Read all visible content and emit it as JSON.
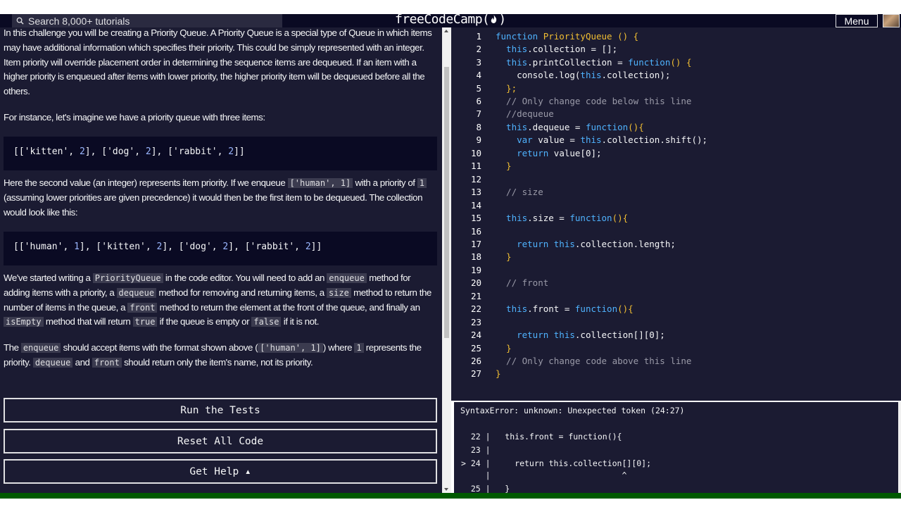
{
  "navbar": {
    "search_placeholder": "Search 8,000+ tutorials",
    "logo_left": "freeCodeCamp(",
    "logo_right": ")",
    "menu_label": "Menu"
  },
  "description": {
    "p1": "In this challenge you will be creating a Priority Queue. A Priority Queue is a special type of Queue in which items may have additional information which specifies their priority. This could be simply represented with an integer. Item priority will override placement order in determining the sequence items are dequeued. If an item with a higher priority is enqueued after items with lower priority, the higher priority item will be dequeued before all the others.",
    "p2": "For instance, let's imagine we have a priority queue with three items:",
    "block1": [
      {
        "t": "[['",
        "c": "s"
      },
      {
        "t": "kitten",
        "c": "s"
      },
      {
        "t": "', ",
        "c": "s"
      },
      {
        "t": "2",
        "c": "n"
      },
      {
        "t": "], ['dog', ",
        "c": "s"
      },
      {
        "t": "2",
        "c": "n"
      },
      {
        "t": "], ['rabbit', ",
        "c": "s"
      },
      {
        "t": "2",
        "c": "n"
      },
      {
        "t": "]]",
        "c": "s"
      }
    ],
    "p3": {
      "a": "Here the second value (an integer) represents item priority. If we enqueue ",
      "code1": "['human', 1]",
      "b": " with a priority of ",
      "code2": "1",
      "c": " (assuming lower priorities are given precedence) it would then be the first item to be dequeued. The collection would look like this:"
    },
    "block2": [
      {
        "t": "[['human', ",
        "c": "s"
      },
      {
        "t": "1",
        "c": "n"
      },
      {
        "t": "], ['kitten', ",
        "c": "s"
      },
      {
        "t": "2",
        "c": "n"
      },
      {
        "t": "], ['dog', ",
        "c": "s"
      },
      {
        "t": "2",
        "c": "n"
      },
      {
        "t": "], ['rabbit', ",
        "c": "s"
      },
      {
        "t": "2",
        "c": "n"
      },
      {
        "t": "]]",
        "c": "s"
      }
    ],
    "p4": {
      "a": "We've started writing a ",
      "code1": "PriorityQueue",
      "b": " in the code editor. You will need to add an ",
      "code2": "enqueue",
      "c": " method for adding items with a priority, a ",
      "code3": "dequeue",
      "d": " method for removing and returning items, a ",
      "code4": "size",
      "e": " method to return the number of items in the queue, a ",
      "code5": "front",
      "f": " method to return the element at the front of the queue, and finally an ",
      "code6": "isEmpty",
      "g": " method that will return ",
      "code7": "true",
      "h": " if the queue is empty or ",
      "code8": "false",
      "i": " if it is not."
    },
    "p5": {
      "a": "The ",
      "code1": "enqueue",
      "b": " should accept items with the format shown above (",
      "code2": "['human', 1]",
      "c": ") where ",
      "code3": "1",
      "d": " represents the priority. ",
      "code4": "dequeue",
      "e": " and ",
      "code5": "front",
      "f": " should return only the item's name, not its priority."
    }
  },
  "buttons": {
    "run": "Run the Tests",
    "reset": "Reset All Code",
    "help": "Get Help ▴"
  },
  "editor": {
    "lines": [
      {
        "n": "1",
        "tokens": [
          {
            "t": "function ",
            "c": "kw"
          },
          {
            "t": "PriorityQueue",
            "c": "fn"
          },
          {
            "t": " () {",
            "c": "br"
          }
        ]
      },
      {
        "n": "2",
        "tokens": [
          {
            "t": "  this",
            "c": "kw"
          },
          {
            "t": ".collection = [];",
            "c": "txt"
          }
        ]
      },
      {
        "n": "3",
        "tokens": [
          {
            "t": "  this",
            "c": "kw"
          },
          {
            "t": ".printCollection = ",
            "c": "txt"
          },
          {
            "t": "function",
            "c": "kw"
          },
          {
            "t": "() {",
            "c": "br"
          }
        ]
      },
      {
        "n": "4",
        "tokens": [
          {
            "t": "    console.log(",
            "c": "txt"
          },
          {
            "t": "this",
            "c": "kw"
          },
          {
            "t": ".collection);",
            "c": "txt"
          }
        ]
      },
      {
        "n": "5",
        "tokens": [
          {
            "t": "  };",
            "c": "br"
          }
        ]
      },
      {
        "n": "6",
        "tokens": [
          {
            "t": "  // Only change code below this line",
            "c": "cm"
          }
        ]
      },
      {
        "n": "7",
        "tokens": [
          {
            "t": "  //dequeue",
            "c": "cm"
          }
        ]
      },
      {
        "n": "8",
        "tokens": [
          {
            "t": "  this",
            "c": "kw"
          },
          {
            "t": ".dequeue = ",
            "c": "txt"
          },
          {
            "t": "function",
            "c": "kw"
          },
          {
            "t": "(){",
            "c": "br"
          }
        ]
      },
      {
        "n": "9",
        "tokens": [
          {
            "t": "    var ",
            "c": "kw"
          },
          {
            "t": "value = ",
            "c": "txt"
          },
          {
            "t": "this",
            "c": "kw"
          },
          {
            "t": ".collection.shift();",
            "c": "txt"
          }
        ]
      },
      {
        "n": "10",
        "tokens": [
          {
            "t": "    return ",
            "c": "kw"
          },
          {
            "t": "value[0];",
            "c": "txt"
          }
        ]
      },
      {
        "n": "11",
        "tokens": [
          {
            "t": "  }",
            "c": "br"
          }
        ]
      },
      {
        "n": "12",
        "tokens": []
      },
      {
        "n": "13",
        "tokens": [
          {
            "t": "  // size",
            "c": "cm"
          }
        ]
      },
      {
        "n": "14",
        "tokens": []
      },
      {
        "n": "15",
        "tokens": [
          {
            "t": "  this",
            "c": "kw"
          },
          {
            "t": ".size = ",
            "c": "txt"
          },
          {
            "t": "function",
            "c": "kw"
          },
          {
            "t": "(){",
            "c": "br"
          }
        ]
      },
      {
        "n": "16",
        "tokens": []
      },
      {
        "n": "17",
        "tokens": [
          {
            "t": "    return this",
            "c": "kw"
          },
          {
            "t": ".collection.length;",
            "c": "txt"
          }
        ]
      },
      {
        "n": "18",
        "tokens": [
          {
            "t": "  }",
            "c": "br"
          }
        ]
      },
      {
        "n": "19",
        "tokens": []
      },
      {
        "n": "20",
        "tokens": [
          {
            "t": "  // front",
            "c": "cm"
          }
        ]
      },
      {
        "n": "21",
        "tokens": []
      },
      {
        "n": "22",
        "tokens": [
          {
            "t": "  this",
            "c": "kw"
          },
          {
            "t": ".front = ",
            "c": "txt"
          },
          {
            "t": "function",
            "c": "kw"
          },
          {
            "t": "(){",
            "c": "br"
          }
        ]
      },
      {
        "n": "23",
        "tokens": []
      },
      {
        "n": "24",
        "tokens": [
          {
            "t": "    return this",
            "c": "kw"
          },
          {
            "t": ".collection[][0];",
            "c": "txt"
          }
        ]
      },
      {
        "n": "25",
        "tokens": [
          {
            "t": "  }",
            "c": "br"
          }
        ]
      },
      {
        "n": "26",
        "tokens": [
          {
            "t": "  // Only change code above this line",
            "c": "cm"
          }
        ]
      },
      {
        "n": "27",
        "tokens": [
          {
            "t": "}",
            "c": "br"
          }
        ]
      }
    ]
  },
  "console": {
    "lines": [
      "SyntaxError: unknown: Unexpected token (24:27)",
      "",
      "  22 |   this.front = function(){",
      "  23 |",
      "> 24 |     return this.collection[][0];",
      "     |                           ^",
      "  25 |   }"
    ]
  },
  "colors": {
    "background": "#1b1b32",
    "navbar": "#0a0a23",
    "keyword": "#4fb3ff",
    "function_name": "#f1be32",
    "comment": "#9a9aa8",
    "footer": "#005a00"
  },
  "icons": {
    "search": "search-icon",
    "logo": "flame-icon",
    "avatar": "user-avatar"
  }
}
